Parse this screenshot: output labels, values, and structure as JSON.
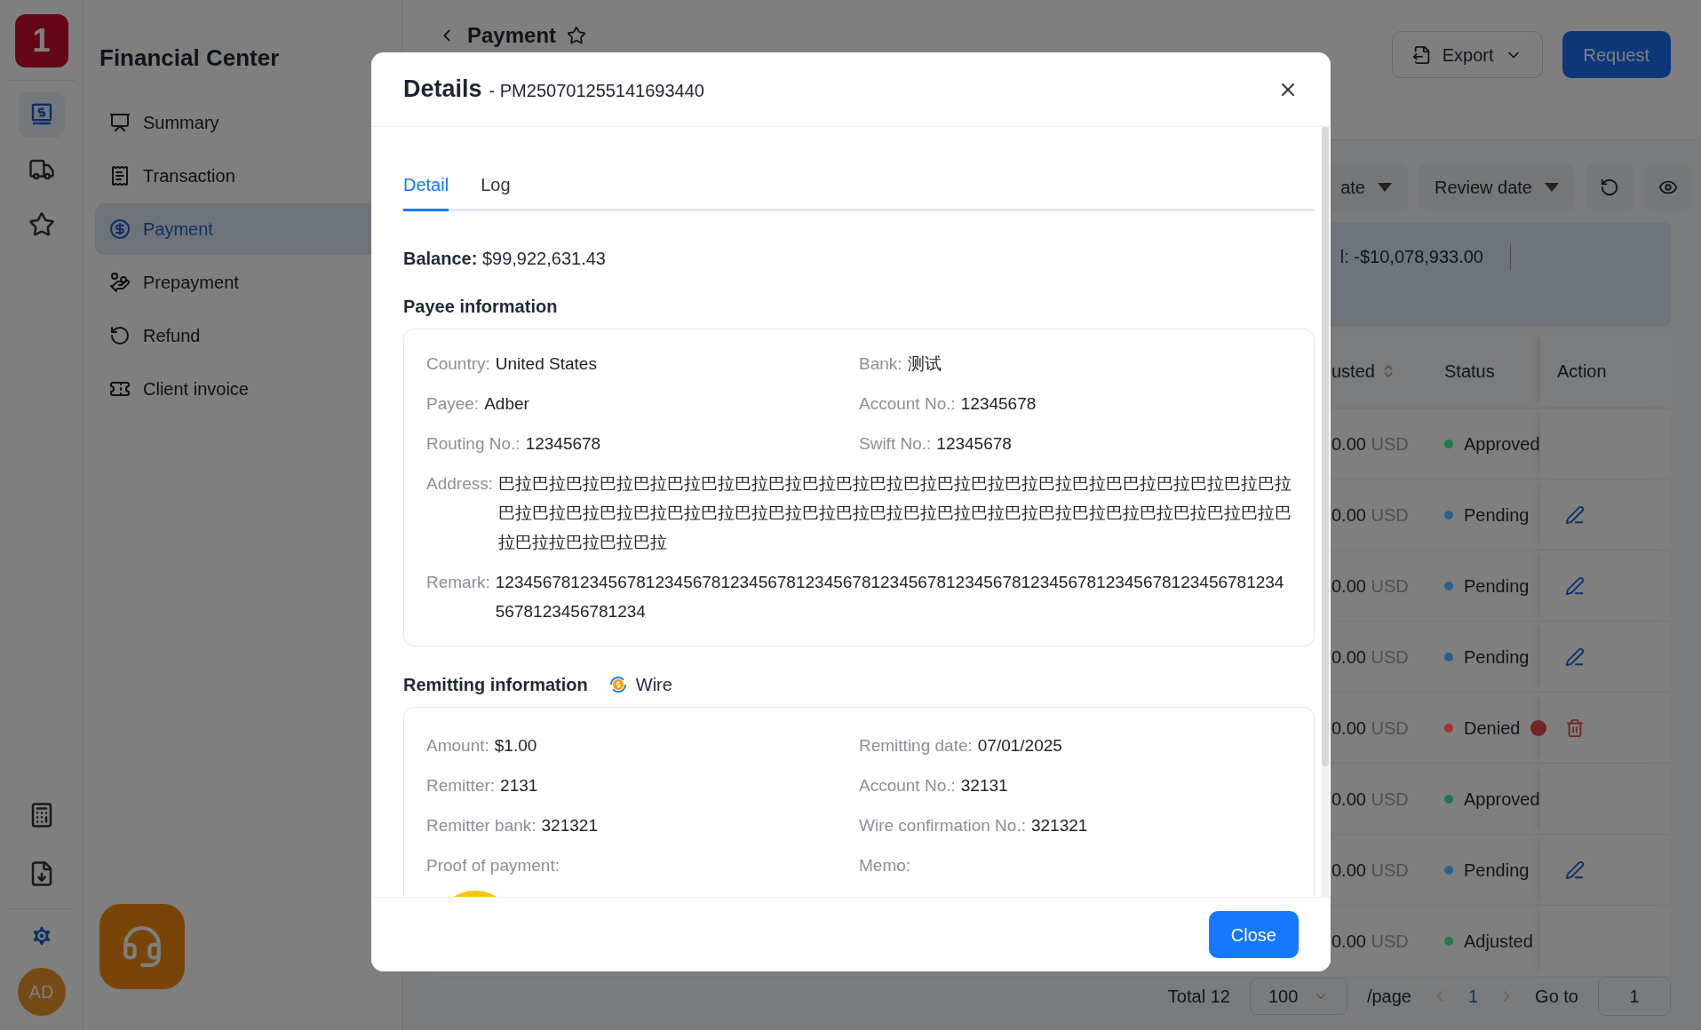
{
  "rail": {
    "logo": "1",
    "items": [
      {
        "kind": "finance",
        "selected": true
      },
      {
        "kind": "truck",
        "selected": false
      },
      {
        "kind": "star",
        "selected": false
      }
    ],
    "tools": [
      {
        "kind": "calculator"
      },
      {
        "kind": "download"
      }
    ],
    "avatar": "AD"
  },
  "sidebar": {
    "title": "Financial Center",
    "items": [
      {
        "label": "Summary",
        "kind": "chart",
        "selected": false
      },
      {
        "label": "Transaction",
        "kind": "receipt",
        "selected": false
      },
      {
        "label": "Payment",
        "kind": "dollar",
        "selected": true
      },
      {
        "label": "Prepayment",
        "kind": "hand",
        "selected": false
      },
      {
        "label": "Refund",
        "kind": "refund",
        "selected": false
      },
      {
        "label": "Client invoice",
        "kind": "ticket",
        "selected": false
      }
    ]
  },
  "page": {
    "title": "Payment",
    "export": "Export",
    "request": "Request",
    "filters": [
      "ate",
      "Review date"
    ],
    "summary": "l: -$10,078,933.00",
    "columns": [
      "usted",
      "Status",
      "Action"
    ],
    "rows": [
      {
        "amount": "0.00",
        "currency": "USD",
        "status": "Approved",
        "color": "#1e7a4a",
        "alert": false,
        "kind": "none"
      },
      {
        "amount": "0.00",
        "currency": "USD",
        "status": "Pending",
        "color": "#2a5f8f",
        "alert": false,
        "kind": "edit"
      },
      {
        "amount": "0.00",
        "currency": "USD",
        "status": "Pending",
        "color": "#2a5f8f",
        "alert": false,
        "kind": "edit"
      },
      {
        "amount": "0.00",
        "currency": "USD",
        "status": "Pending",
        "color": "#2a5f8f",
        "alert": false,
        "kind": "edit"
      },
      {
        "amount": "0.00",
        "currency": "USD",
        "status": "Denied",
        "color": "#a83030",
        "alert": true,
        "kind": "delete"
      },
      {
        "amount": "0.00",
        "currency": "USD",
        "status": "Approved",
        "color": "#1e7a4a",
        "alert": false,
        "kind": "none"
      },
      {
        "amount": "0.00",
        "currency": "USD",
        "status": "Pending",
        "color": "#2a5f8f",
        "alert": false,
        "kind": "edit"
      },
      {
        "amount": "0.00",
        "currency": "USD",
        "status": "Adjusted",
        "color": "#1e7a4a",
        "alert": false,
        "kind": "none"
      }
    ],
    "pagination": {
      "total": "Total 12",
      "page_size": "100",
      "per_page": "/page",
      "current": "1",
      "goto_label": "Go to",
      "goto_value": "1"
    }
  },
  "modal": {
    "title": "Details",
    "id": "- PM250701255141693440",
    "tabs": [
      {
        "label": "Detail",
        "selected": true
      },
      {
        "label": "Log",
        "selected": false
      }
    ],
    "balance": {
      "label": "Balance:",
      "value": "$99,922,631.43"
    },
    "payee": {
      "title": "Payee information",
      "fields": [
        {
          "label": "Country:",
          "value": "United States",
          "wide": false
        },
        {
          "label": "Bank:",
          "value": "测试",
          "wide": false
        },
        {
          "label": "Payee:",
          "value": "Adber",
          "wide": false
        },
        {
          "label": "Account No.:",
          "value": "12345678",
          "wide": false
        },
        {
          "label": "Routing No.:",
          "value": "12345678",
          "wide": false
        },
        {
          "label": "Swift No.:",
          "value": "12345678",
          "wide": false
        },
        {
          "label": "Address:",
          "value": "巴拉巴拉巴拉巴拉巴拉巴拉巴拉巴拉巴拉巴拉巴拉巴拉巴拉巴拉巴拉巴拉巴拉巴拉巴巴拉巴拉巴拉巴拉巴拉巴拉巴拉巴拉巴拉巴拉巴拉巴拉巴拉巴拉巴拉巴拉巴拉巴拉巴拉巴拉巴拉巴拉巴拉巴拉巴拉巴拉巴拉巴拉巴拉巴拉拉巴拉巴拉巴拉",
          "wide": true
        },
        {
          "label": "Remark:",
          "value": "1234567812345678123456781234567812345678123456781234567812345678123456781234567812345678123456781234",
          "wide": true
        }
      ]
    },
    "remitting": {
      "title": "Remitting information",
      "method": "Wire",
      "fields": [
        {
          "label": "Amount:",
          "value": "$1.00"
        },
        {
          "label": "Remitting date:",
          "value": "07/01/2025"
        },
        {
          "label": "Remitter:",
          "value": "2131"
        },
        {
          "label": "Account No.:",
          "value": "32131"
        },
        {
          "label": "Remitter bank:",
          "value": "321321"
        },
        {
          "label": "Wire confirmation No.:",
          "value": "321321"
        },
        {
          "label": "Proof of payment:",
          "kind": "picture"
        },
        {
          "label": "Memo:"
        }
      ]
    },
    "close": "Close"
  }
}
